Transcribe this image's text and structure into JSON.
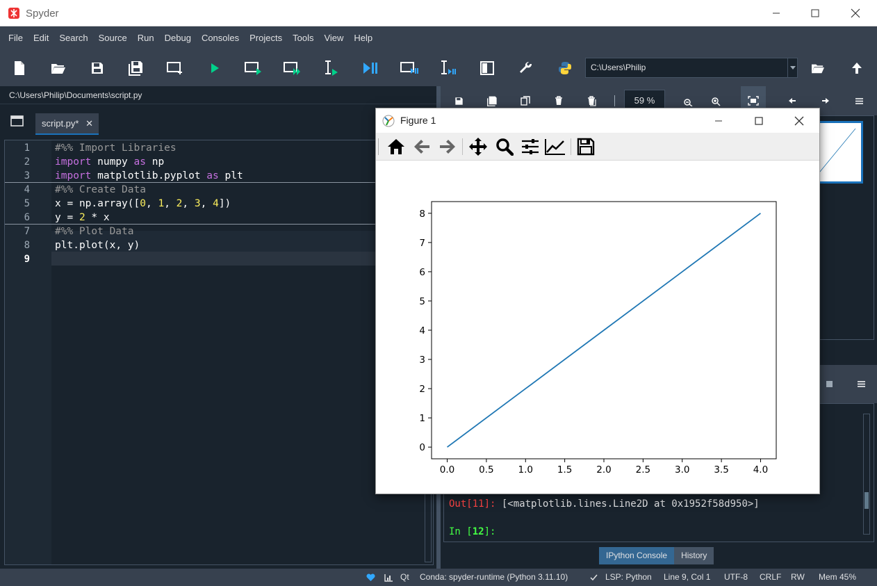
{
  "window": {
    "title": "Spyder"
  },
  "menu": [
    "File",
    "Edit",
    "Search",
    "Source",
    "Run",
    "Debug",
    "Consoles",
    "Projects",
    "Tools",
    "View",
    "Help"
  ],
  "toolbar": {
    "working_dir": "C:\\Users\\Philip"
  },
  "editor": {
    "file_path": "C:\\Users\\Philip\\Documents\\script.py",
    "tab_label": "script.py*",
    "tab_close": "✕",
    "current_line": 9,
    "line_numbers": [
      "1",
      "2",
      "3",
      "4",
      "5",
      "6",
      "7",
      "8",
      "9"
    ],
    "lines": [
      "#%% Import Libraries",
      "import numpy as np",
      "import matplotlib.pyplot as plt",
      "#%% Create Data",
      "x = np.array([0, 1, 2, 3, 4])",
      "y = 2 * x",
      "#%% Plot Data",
      "plt.plot(x, y)",
      ""
    ]
  },
  "plots_pane": {
    "zoom": "59 %"
  },
  "console": {
    "out_prompt": "Out[11]:",
    "out_text": " [<matplotlib.lines.Line2D at 0x1952f58d950>]",
    "in_prompt_prefix": "In [",
    "in_prompt_num": "12",
    "in_prompt_suffix": "]:",
    "tabs": [
      "IPython Console",
      "History"
    ]
  },
  "statusbar": {
    "qt": "Qt",
    "conda": "Conda: spyder-runtime (Python 3.11.10)",
    "lsp": "LSP: Python",
    "position": "Line 9, Col 1",
    "encoding": "UTF-8",
    "eol": "CRLF",
    "rw": "RW",
    "mem": "Mem 45%"
  },
  "figure": {
    "title": "Figure 1"
  },
  "colors": {
    "accent": "#1a72bb",
    "line": "#1f77b4",
    "run_green": "#00d08a",
    "debug_blue": "#31a8ff"
  },
  "chart_data": {
    "type": "line",
    "x": [
      0,
      1,
      2,
      3,
      4
    ],
    "series": [
      {
        "values": [
          0,
          2,
          4,
          6,
          8
        ]
      }
    ],
    "xlim": [
      -0.2,
      4.2
    ],
    "ylim": [
      -0.4,
      8.4
    ],
    "xticks": [
      0,
      0.5,
      1,
      1.5,
      2,
      2.5,
      3,
      3.5,
      4
    ],
    "xtick_labels": [
      "0.0",
      "0.5",
      "1.0",
      "1.5",
      "2.0",
      "2.5",
      "3.0",
      "3.5",
      "4.0"
    ],
    "yticks": [
      0,
      1,
      2,
      3,
      4,
      5,
      6,
      7,
      8
    ],
    "ytick_labels": [
      "0",
      "1",
      "2",
      "3",
      "4",
      "5",
      "6",
      "7",
      "8"
    ],
    "grid": false,
    "title": "",
    "xlabel": "",
    "ylabel": ""
  }
}
